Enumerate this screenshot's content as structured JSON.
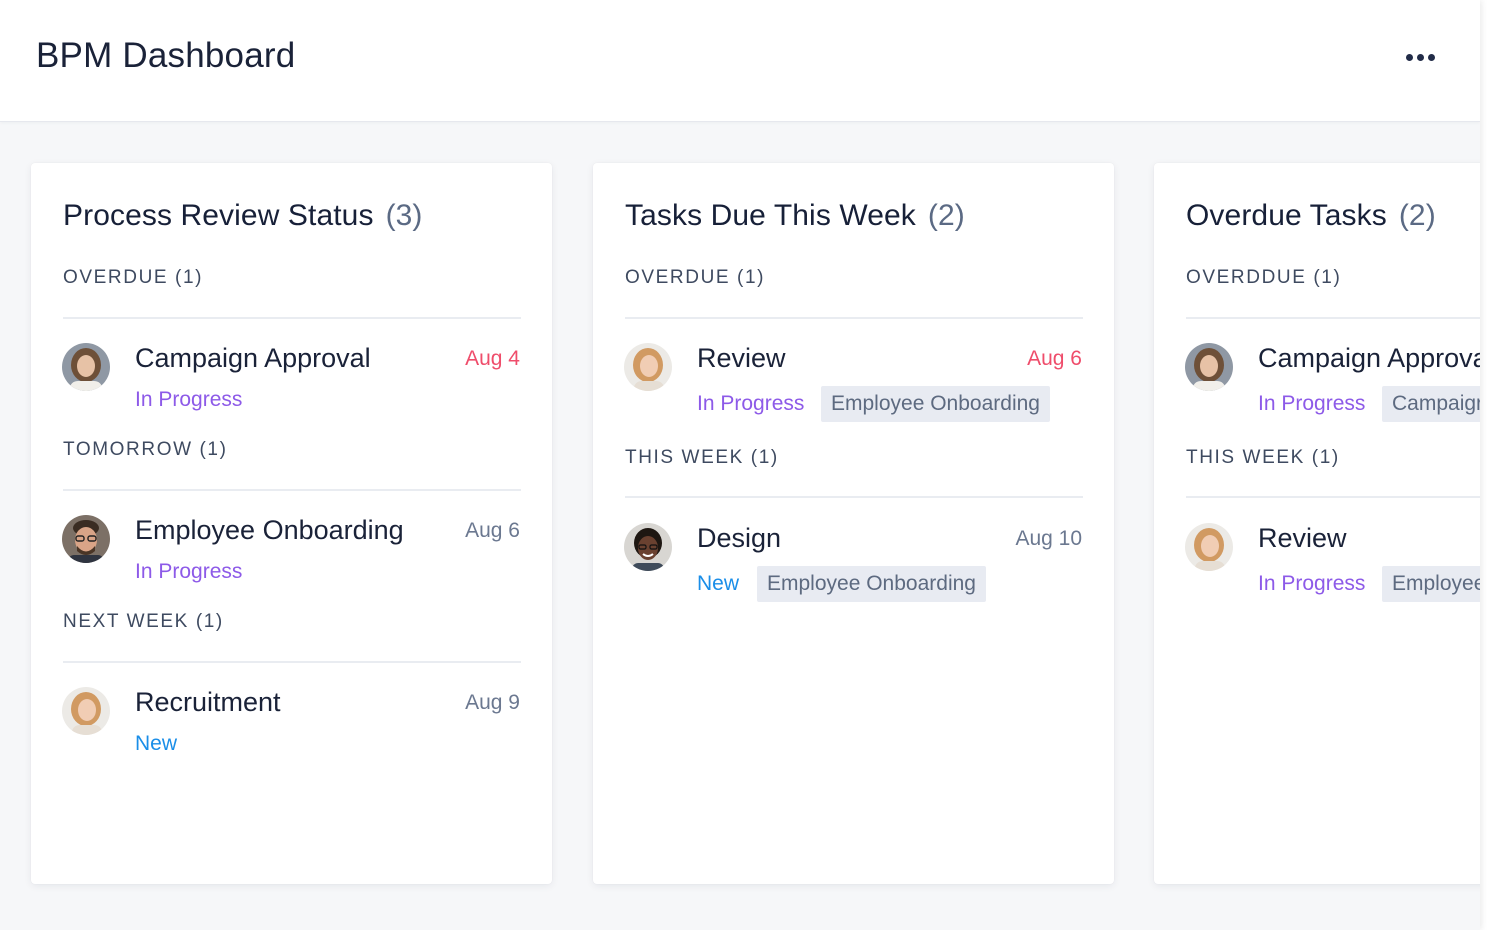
{
  "header": {
    "title": "BPM Dashboard",
    "more_icon": "more-horizontal-icon"
  },
  "colors": {
    "overdue_date": "#ef4d6b",
    "in_progress": "#8d5ae8",
    "new": "#1a8ee8",
    "chip_bg": "#e8ebf2"
  },
  "cards": [
    {
      "title": "Process Review Status",
      "count": "(3)",
      "sections": [
        {
          "label": "OVERDUE (1)",
          "tasks": [
            {
              "name": "Campaign Approval",
              "date": "Aug 4",
              "status": "In Progress",
              "avatar": "avatar-woman-dark-blonde"
            }
          ]
        },
        {
          "label": "TOMORROW (1)",
          "tasks": [
            {
              "name": "Employee Onboarding",
              "date": "Aug 6",
              "status": "In Progress",
              "avatar": "avatar-man-glasses"
            }
          ]
        },
        {
          "label": "NEXT WEEK (1)",
          "tasks": [
            {
              "name": "Recruitment",
              "date": "Aug 9",
              "status": "New",
              "avatar": "avatar-woman-blonde"
            }
          ]
        }
      ]
    },
    {
      "title": "Tasks Due This Week",
      "count": "(2)",
      "sections": [
        {
          "label": "OVERDUE (1)",
          "tasks": [
            {
              "name": "Review",
              "date": "Aug 6",
              "status": "In Progress",
              "tag": "Employee Onboarding",
              "avatar": "avatar-woman-blonde"
            }
          ]
        },
        {
          "label": "THIS WEEK (1)",
          "tasks": [
            {
              "name": "Design",
              "date": "Aug 10",
              "status": "New",
              "tag": "Employee Onboarding",
              "avatar": "avatar-woman-dark-skin"
            }
          ]
        }
      ]
    },
    {
      "title": "Overdue Tasks",
      "count": "(2)",
      "sections": [
        {
          "label": "OVERDDUE (1)",
          "tasks": [
            {
              "name": "Campaign Approva",
              "status": "In Progress",
              "tag": "Campaigr",
              "avatar": "avatar-woman-dark-blonde"
            }
          ]
        },
        {
          "label": "THIS WEEK (1)",
          "tasks": [
            {
              "name": "Review",
              "status": "In Progress",
              "tag": "Employee",
              "avatar": "avatar-woman-blonde"
            }
          ]
        }
      ]
    }
  ]
}
